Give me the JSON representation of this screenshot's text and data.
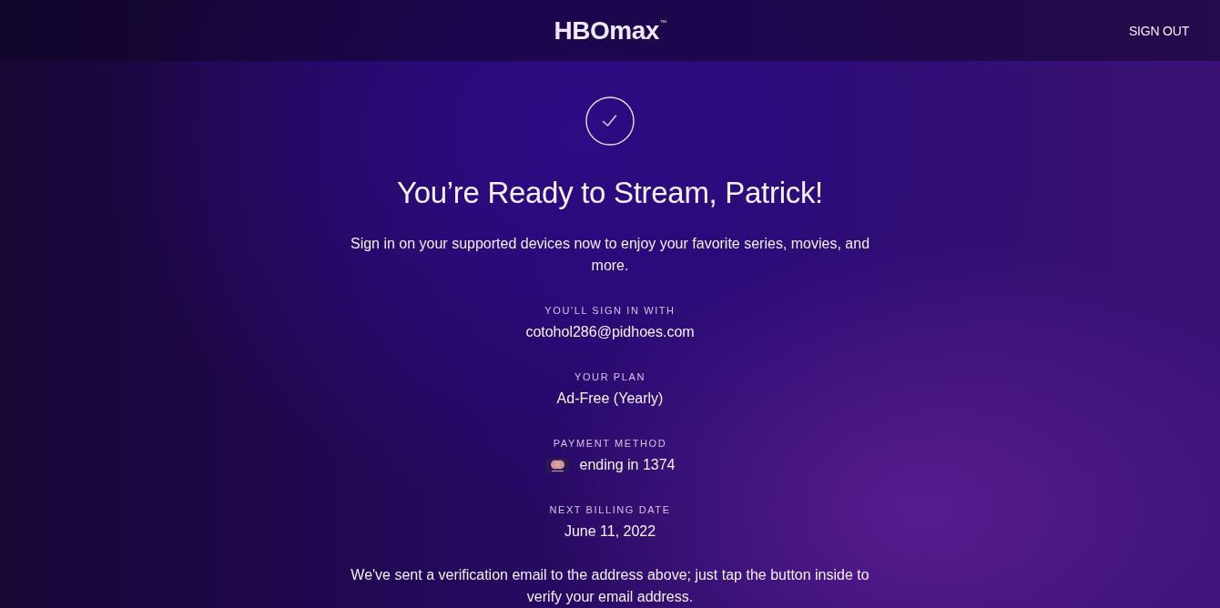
{
  "header": {
    "logo": "HBOmax$^{™}$",
    "sign_out": "SIGN OUT"
  },
  "confirmation": {
    "title": "You’re Ready to Stream, Patrick!",
    "message": "Sign in on your supported devices now to enjoy your favorite series, movies, and more."
  },
  "details": [
    {
      "kind": "text",
      "label": "YOU'LL SIGN IN WITH",
      "value": "cotohol286@pidhoes.com"
    },
    {
      "kind": "text",
      "label": "YOUR PLAN",
      "value": "Ad-Free (Yearly)"
    },
    {
      "kind": "card",
      "label": "PAYMENT METHOD",
      "value": "ending in 1374"
    },
    {
      "kind": "text",
      "label": "NEXT BILLING DATE",
      "value": "June 11, 2022"
    }
  ],
  "note": "We've sent a verification email to the address above; just tap the button inside to verify your email address."
}
